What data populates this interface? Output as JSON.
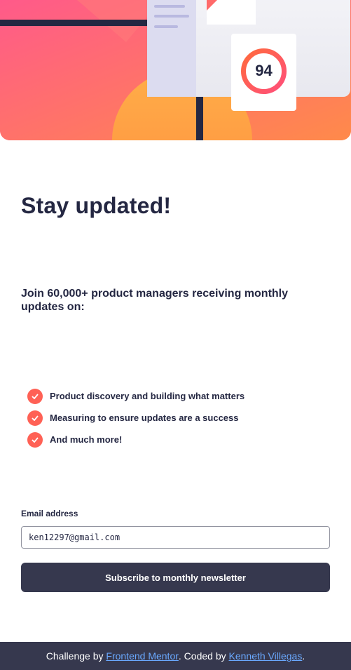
{
  "hero": {
    "score": "94"
  },
  "title": "Stay updated!",
  "intro": "Join 60,000+ product managers receiving monthly updates on:",
  "features": [
    {
      "label": "Product discovery and building what matters"
    },
    {
      "label": "Measuring to ensure updates are a success"
    },
    {
      "label": "And much more!"
    }
  ],
  "form": {
    "email_label": "Email address",
    "email_value": "ken12297@gmail.com",
    "submit_label": "Subscribe to monthly newsletter"
  },
  "footer": {
    "prefix": "Challenge by ",
    "link1": "Frontend Mentor",
    "middle": ". Coded by ",
    "link2": "Kenneth Villegas",
    "suffix": "."
  },
  "colors": {
    "tomato": "#ff6155",
    "dark_navy": "#242742",
    "charcoal": "#36384e",
    "link": "#6aa9ff"
  }
}
